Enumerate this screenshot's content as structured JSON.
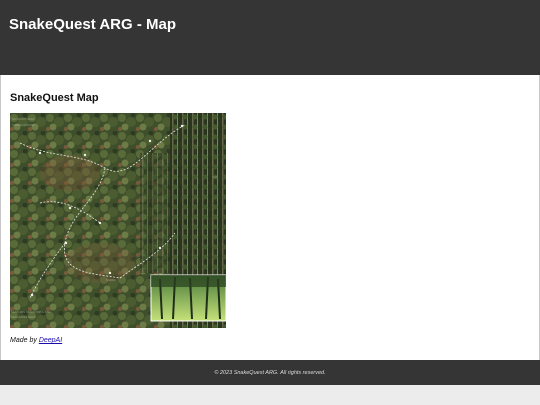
{
  "header": {
    "title": "SnakeQuest ARG - Map"
  },
  "main": {
    "section_title": "SnakeQuest Map",
    "credit_prefix": "Made by",
    "credit_link": "DeepAI"
  },
  "footer": {
    "text": "© 2023 SnakeQuest ARG. All rights reserved."
  },
  "colors": {
    "header_bg": "#353535",
    "link": "#1a0dab",
    "forest_dark": "#2f3d22",
    "forest_mid": "#5a6b3a",
    "path": "#e8e8e0"
  }
}
